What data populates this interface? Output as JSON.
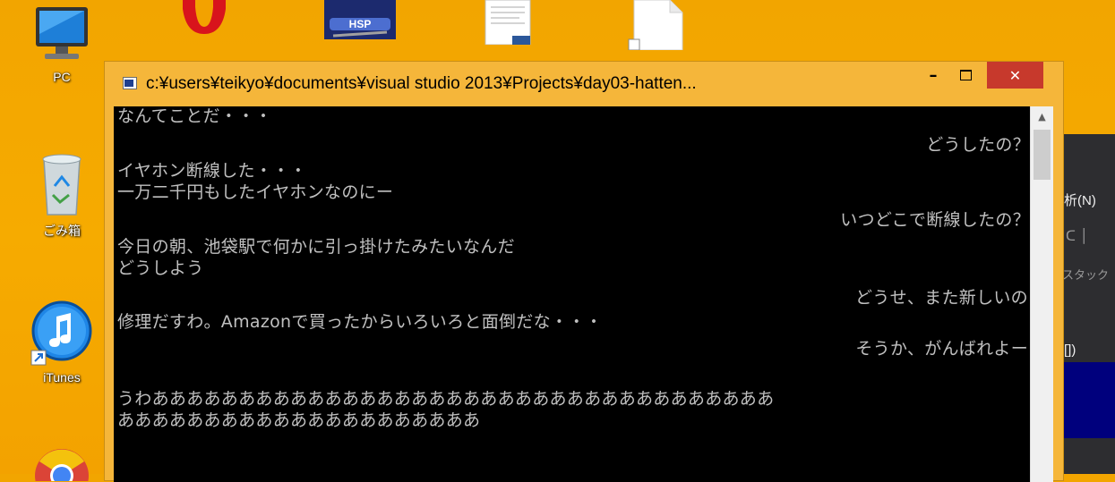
{
  "desktop": {
    "icons": [
      {
        "label": "PC",
        "icon": "pc-icon"
      },
      {
        "label": "ごみ箱",
        "icon": "recycle-bin-icon"
      },
      {
        "label": "iTunes",
        "icon": "itunes-icon"
      }
    ]
  },
  "background_window": {
    "menu_label": "析(N)",
    "stack_label": "スタック",
    "bracket_label": "[])"
  },
  "console": {
    "title": "c:¥users¥teikyo¥documents¥visual studio 2013¥Projects¥day03-hatten...",
    "minimize_label": "–",
    "close_label": "✕",
    "lines": [
      {
        "text": "なんてことだ・・・",
        "align": "left"
      },
      {
        "text": "どうしたの？",
        "align": "right"
      },
      {
        "text": "イヤホン断線した・・・",
        "align": "left"
      },
      {
        "text": "一万二千円もしたイヤホンなのにー",
        "align": "left"
      },
      {
        "text": "いつどこで断線したの？",
        "align": "right"
      },
      {
        "text": "今日の朝、池袋駅で何かに引っ掛けたみたいなんだ",
        "align": "left"
      },
      {
        "text": "どうしよう",
        "align": "left"
      },
      {
        "text": "どうせ、また新しいの",
        "align": "right"
      },
      {
        "text": "修理だすわ。Amazonで買ったからいろいろと面倒だな・・・",
        "align": "left"
      },
      {
        "text": "そうか、がんばれよー",
        "align": "right"
      },
      {
        "text": "うわああああああああああああああああああああああああああああああああああああ",
        "align": "left"
      },
      {
        "text": "あああああああああああああああああああああ",
        "align": "left"
      }
    ]
  }
}
